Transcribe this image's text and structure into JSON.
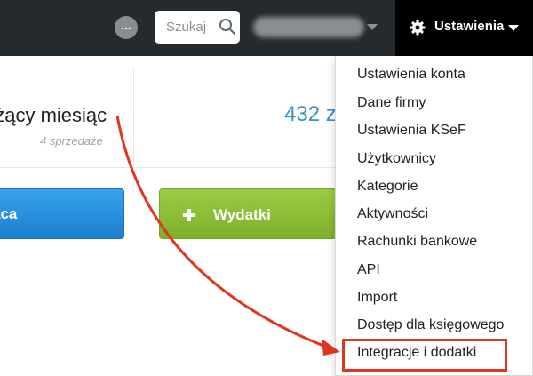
{
  "topbar": {
    "more_label": "...",
    "search_placeholder": "Szukaj",
    "user_name": "",
    "settings_label": "Ustawienia"
  },
  "stats": {
    "period_label": "eżący miesiąc",
    "sales_count": "4 sprzedaże",
    "amount": "432 z"
  },
  "actions": {
    "income_label": "ąca",
    "expenses_label": "Wydatki"
  },
  "settings_menu": {
    "items": [
      "Ustawienia konta",
      "Dane firmy",
      "Ustawienia KSeF",
      "Użytkownicy",
      "Kategorie",
      "Aktywności",
      "Rachunki bankowe",
      "API",
      "Import",
      "Dostęp dla księgowego",
      "Integracje i dodatki"
    ],
    "highlighted_item": "Integracje i dodatki"
  },
  "colors": {
    "topbar": "#252a2f",
    "settings_button": "#000000",
    "amount": "#3d8fcb",
    "income_button": "#1c7fd0",
    "expenses_button": "#8bbd37",
    "annotation": "#e0351f"
  },
  "icons": [
    "more-icon",
    "search-icon",
    "user-caret-icon",
    "gear-icon",
    "caret-down-icon",
    "plus-icon"
  ]
}
